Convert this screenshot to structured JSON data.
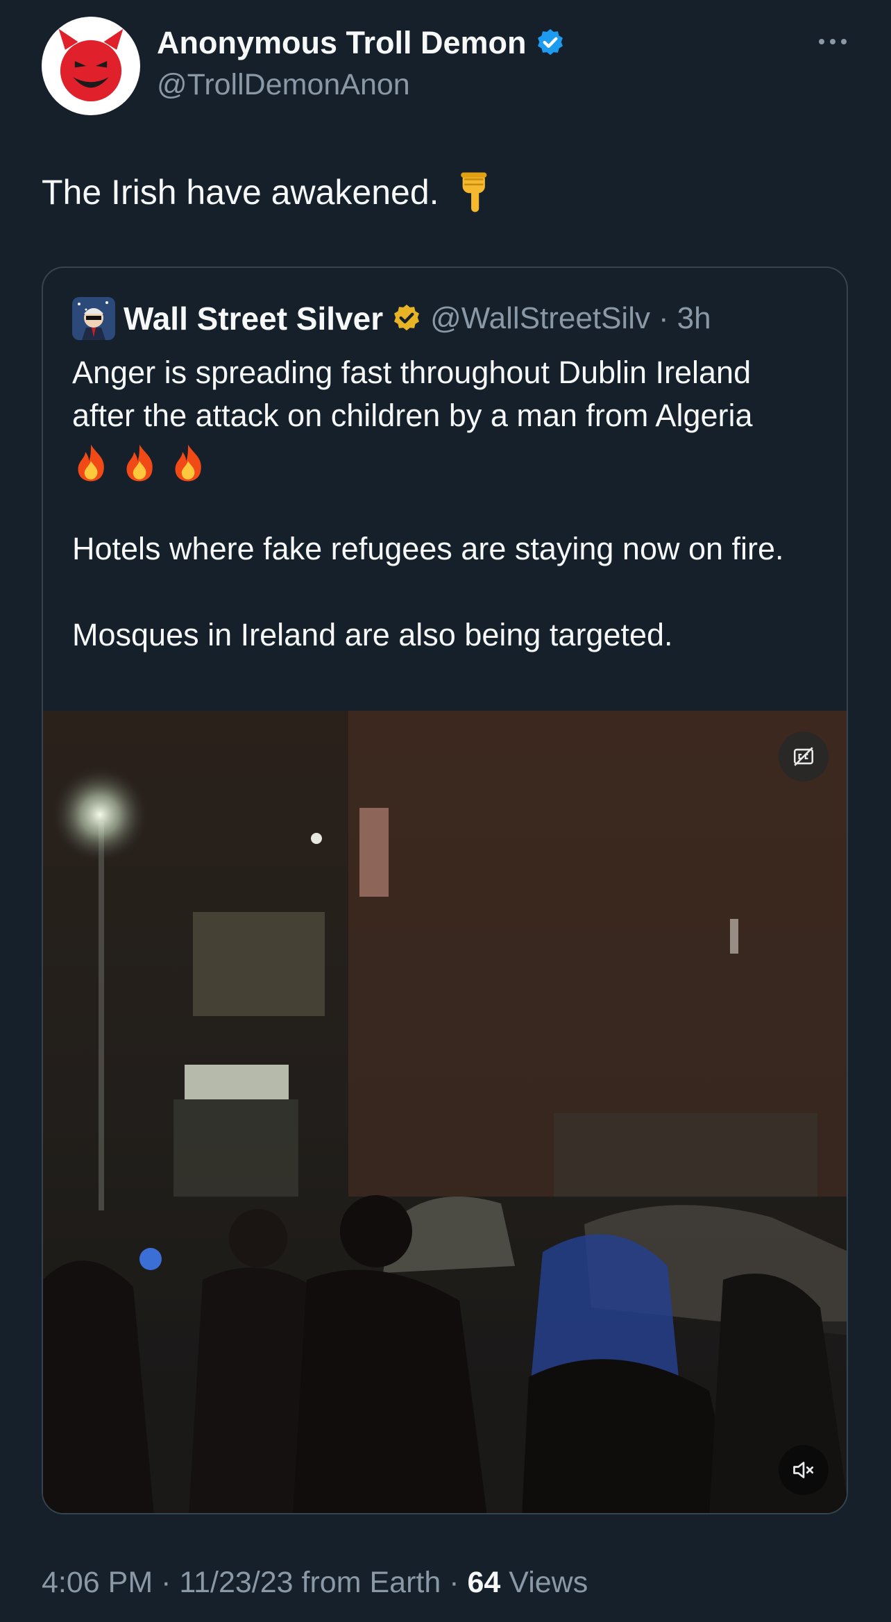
{
  "author": {
    "display_name": "Anonymous Troll Demon",
    "handle": "@TrollDemonAnon",
    "avatar_icon": "smiling-devil-emoji",
    "verified_color": "#1d9bf0"
  },
  "tweet": {
    "text": "The Irish have awakened.",
    "emoji_icon": "backhand-index-pointing-down"
  },
  "quoted_tweet": {
    "display_name": "Wall Street Silver",
    "handle": "@WallStreetSilv",
    "separator": "·",
    "time": "3h",
    "verified_color": "#e8b426",
    "line1": "Anger is spreading fast throughout Dublin Ireland after the attack on children by a man from Algeria",
    "line2": "Hotels where fake refugees are staying now on fire.",
    "line3": "Mosques in Ireland are also being targeted.",
    "media": {
      "type": "video",
      "cc_icon": "captions-off-icon",
      "mute_icon": "volume-muted-icon"
    }
  },
  "meta": {
    "time": "4:06 PM",
    "sep1": "·",
    "date": "11/23/23",
    "source": "from Earth",
    "sep2": "·",
    "views_count": "64",
    "views_label": "Views"
  },
  "colors": {
    "background": "#15202b",
    "text": "#f7f9f9",
    "secondary": "#8b98a5",
    "border": "#38444d"
  }
}
